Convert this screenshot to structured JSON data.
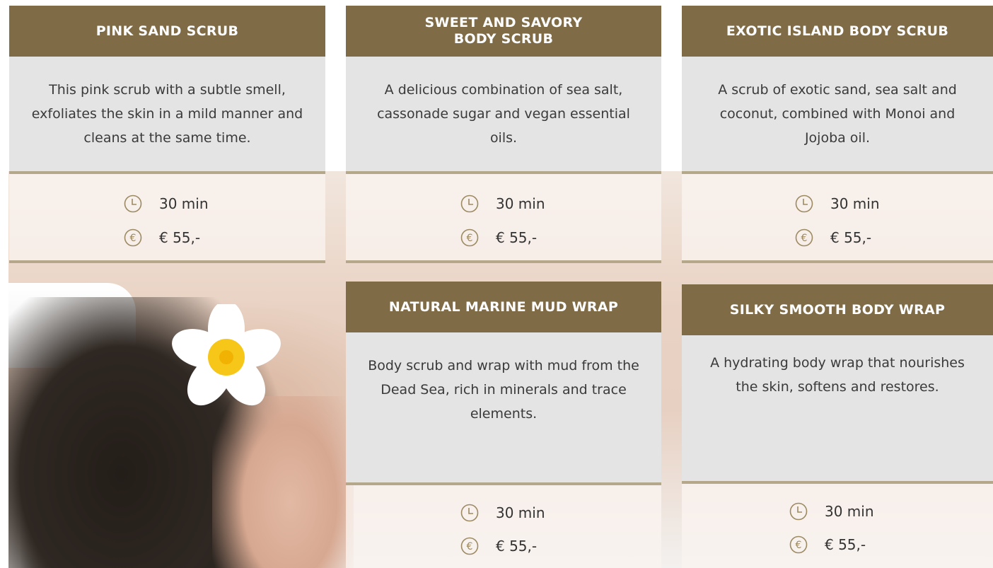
{
  "cards": [
    {
      "title": "PINK SAND SCRUB",
      "description": "This pink scrub with a subtle smell, exfoliates the skin in a mild manner and cleans at the same time.",
      "duration": "30 min",
      "price": "€ 55,-"
    },
    {
      "title": "SWEET AND SAVORY\nBODY SCRUB",
      "description": "A delicious combination of sea salt, cassonade sugar and vegan essential oils.",
      "duration": "30 min",
      "price": "€ 55,-"
    },
    {
      "title": "EXOTIC ISLAND BODY SCRUB",
      "description": "A scrub of exotic sand, sea salt and coconut, combined with Monoi and Jojoba oil.",
      "duration": "30 min",
      "price": "€ 55,-"
    },
    {
      "title": "NATURAL MARINE MUD WRAP",
      "description": "Body scrub and wrap with mud from the Dead Sea, rich in minerals and trace elements.",
      "duration": "30 min",
      "price": "€ 55,-"
    },
    {
      "title": "SILKY SMOOTH BODY WRAP",
      "description": "A hydrating body wrap that nourishes the skin, softens and restores.",
      "duration": "30 min",
      "price": "€ 55,-"
    }
  ],
  "icons": {
    "duration": "clock-icon",
    "price": "euro-icon"
  },
  "colors": {
    "header_bg": "#7f6c47",
    "header_text": "#ffffff",
    "desc_bg": "#e4e4e5",
    "accent_line": "#b4a78a",
    "icon_stroke": "#9c8a62"
  }
}
